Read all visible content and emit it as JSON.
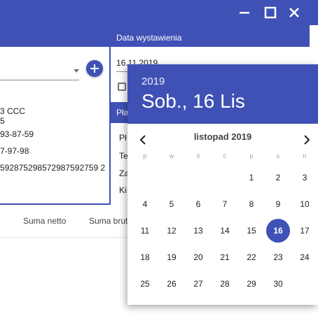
{
  "colors": {
    "primary": "#3f51b5",
    "surface": "#ffffff",
    "text": "#212121",
    "muted": "#9e9e9e"
  },
  "window": {
    "controls": [
      {
        "name": "minimize",
        "icon": "minimize-icon"
      },
      {
        "name": "maximize",
        "icon": "maximize-icon"
      },
      {
        "name": "close",
        "icon": "close-icon"
      }
    ]
  },
  "header": {
    "date_label": "Data wystawienia"
  },
  "left_panel": {
    "lines": [
      "3 CCC",
      "5",
      "93-87-59",
      "7-97-98",
      "592875298572987592759 2"
    ]
  },
  "date_field": {
    "value": "16.11.2019"
  },
  "payment": {
    "header": "Pła",
    "items": [
      "Pł",
      "Te",
      "Za",
      "Ki"
    ]
  },
  "table": {
    "columns": [
      "Suma netto",
      "Suma brutto"
    ]
  },
  "datepicker": {
    "year": "2019",
    "selected_label": "Sob., 16 Lis",
    "month": "listopad 2019",
    "weekdays": [
      "p",
      "w",
      "ś",
      "c",
      "p",
      "s",
      "n"
    ],
    "selected_day": "16",
    "weeks": [
      [
        "",
        "",
        "",
        "",
        "1",
        "2",
        "3"
      ],
      [
        "4",
        "5",
        "6",
        "7",
        "8",
        "9",
        "10"
      ],
      [
        "11",
        "12",
        "13",
        "14",
        "15",
        "16",
        "17"
      ],
      [
        "18",
        "19",
        "20",
        "21",
        "22",
        "23",
        "24"
      ],
      [
        "25",
        "26",
        "27",
        "28",
        "29",
        "30",
        ""
      ]
    ]
  }
}
